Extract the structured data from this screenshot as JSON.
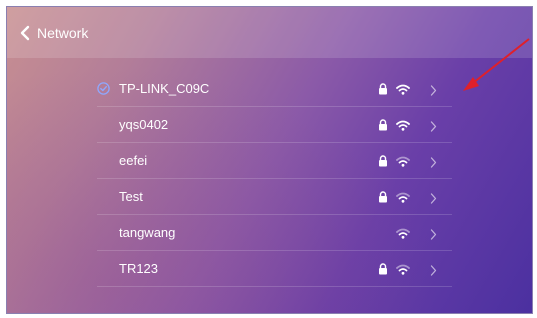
{
  "header": {
    "title": "Network",
    "back_icon": "chevron-left-icon"
  },
  "networks": [
    {
      "ssid": "TP-LINK_C09C",
      "connected": true,
      "secured": true,
      "signal": "strong"
    },
    {
      "ssid": "yqs0402",
      "connected": false,
      "secured": true,
      "signal": "strong"
    },
    {
      "ssid": "eefei",
      "connected": false,
      "secured": true,
      "signal": "medium"
    },
    {
      "ssid": "Test",
      "connected": false,
      "secured": true,
      "signal": "medium"
    },
    {
      "ssid": "tangwang",
      "connected": false,
      "secured": false,
      "signal": "medium"
    },
    {
      "ssid": "TR123",
      "connected": false,
      "secured": true,
      "signal": "medium"
    }
  ],
  "icons": {
    "connected": "check-circle-icon",
    "secured": "lock-icon",
    "signal": "wifi-icon",
    "more": "chevron-right-icon",
    "annotation": "red-arrow-icon"
  },
  "colors": {
    "check": "#8fa8ff",
    "annotation_arrow": "#e0202a",
    "text": "#ffffff"
  }
}
